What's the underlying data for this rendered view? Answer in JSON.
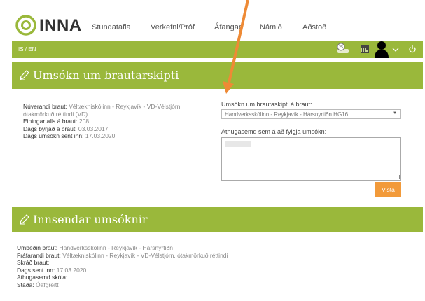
{
  "header": {
    "logo_text": "INNA",
    "nav": [
      "Stundatafla",
      "Verkefni/Próf",
      "Áfangar",
      "Námið",
      "Aðstoð"
    ]
  },
  "strip": {
    "language": "IS / EN",
    "icons": [
      "notification-icon",
      "calendar-icon",
      "user-icon",
      "chevron-down-icon",
      "power-icon"
    ]
  },
  "application": {
    "title": "Umsókn um brautarskipti",
    "info": [
      {
        "label": "Núverandi braut:",
        "value": "Véltækniskólinn - Reykjavík - VD-Vélstjórn,",
        "cont": "ótakmörkuð réttindi (VD)"
      },
      {
        "label": "Einingar alls á braut:",
        "value": "208"
      },
      {
        "label": "Dags byrjað á braut:",
        "value": "03.03.2017"
      },
      {
        "label": "Dags umsókn sent inn:",
        "value": "17.03.2020"
      }
    ],
    "select_label": "Umsókn um brautaskipti á braut:",
    "select_value": "Handverksskólinn - Reykjavík - Hársnyrtiðn HG16",
    "comment_label": "Athugasemd sem á að fylgja umsókn:",
    "save_label": "Vista"
  },
  "submitted": {
    "title": "Innsendar umsóknir",
    "rows": [
      {
        "label": "Umbeðin braut:",
        "value": "Handverksskólinn - Reykjavík - Hársnyrtiðn"
      },
      {
        "label": "Fráfarandi braut:",
        "value": "Véltækniskólinn - Reykjavík - VD-Vélstjórn, ótakmörkuð réttindi"
      },
      {
        "label": "Skráð braut:",
        "value": ""
      },
      {
        "label": "Dags sent inn:",
        "value": "17.03.2020"
      },
      {
        "label": "Athugasemd skóla:",
        "value": ""
      },
      {
        "label": "Staða:",
        "value": "Óafgreitt"
      }
    ]
  },
  "colors": {
    "accent": "#9ab83b",
    "button": "#f29a3a",
    "annotation_arrow": "#ee8a35"
  }
}
